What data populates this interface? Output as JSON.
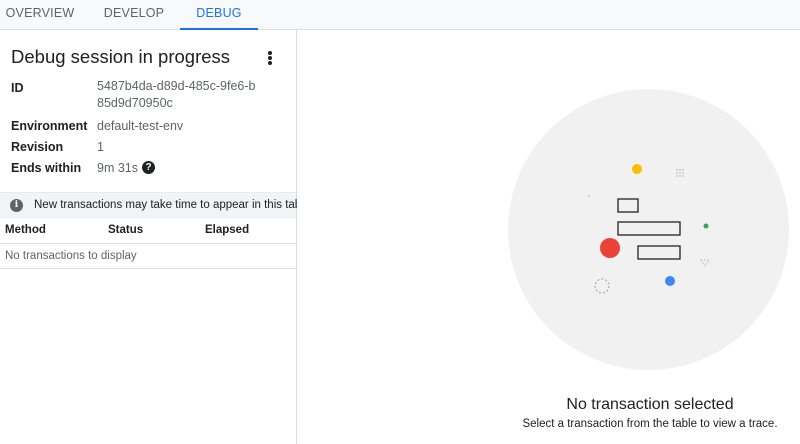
{
  "tabs": [
    {
      "label": "OVERVIEW",
      "active": false
    },
    {
      "label": "DEVELOP",
      "active": false
    },
    {
      "label": "DEBUG",
      "active": true
    }
  ],
  "session": {
    "title": "Debug session in progress",
    "more_icon": "more-vert-icon",
    "details": {
      "id_label": "ID",
      "id_value": "5487b4da-d89d-485c-9fe6-b85d9d70950c",
      "environment_label": "Environment",
      "environment_value": "default-test-env",
      "revision_label": "Revision",
      "revision_value": "1",
      "ends_label": "Ends within",
      "ends_value": "9m 31s",
      "help_icon": "help-icon"
    }
  },
  "info_bar": {
    "icon": "info-icon",
    "text": "New transactions may take time to appear in this table"
  },
  "transactions_table": {
    "columns": [
      "Method",
      "Status",
      "Elapsed"
    ],
    "empty_text": "No transactions to display"
  },
  "empty_state": {
    "title": "No transaction selected",
    "subtitle": "Select a transaction from the table to view a trace.",
    "colors": {
      "circle": "#f1f1f1",
      "yellow": "#fbbc04",
      "red": "#ea4335",
      "blue": "#4285f4",
      "green": "#34a853"
    }
  },
  "colors": {
    "accent": "#1a73e8",
    "tab_inactive": "#5f6368",
    "border": "#dadce0"
  }
}
